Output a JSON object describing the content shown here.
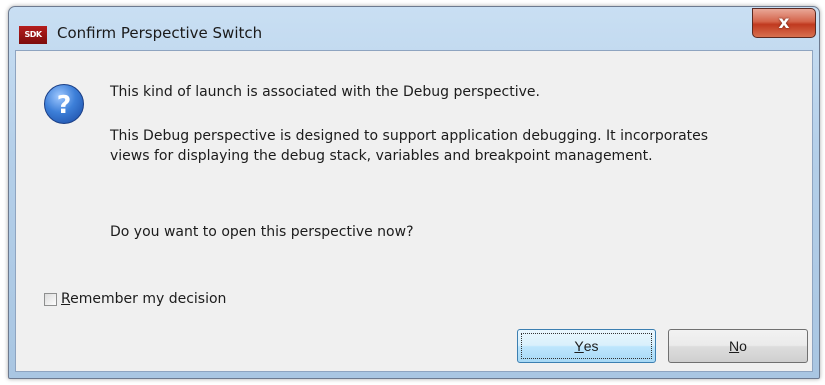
{
  "window": {
    "title": "Confirm Perspective Switch",
    "app_icon_text": "SDK",
    "close_symbol": "x"
  },
  "message": {
    "line1": "This kind of launch is associated with the Debug perspective.",
    "line2": "This Debug perspective is designed to support application debugging.  It incorporates views for displaying the debug stack, variables and breakpoint management.",
    "line3": "Do you want to open this perspective now?"
  },
  "remember": {
    "mnemonic": "R",
    "label_rest": "emember my decision",
    "checked": false
  },
  "buttons": {
    "yes_mnemonic": "Y",
    "yes_rest": "es",
    "no_mnemonic": "N",
    "no_rest": "o"
  },
  "icons": {
    "dialog_icon": "question-icon",
    "question_glyph": "?"
  },
  "colors": {
    "titlebar": "#b4cfe9",
    "close_button": "#c0391f",
    "client_bg": "#f0f0f0",
    "default_button_border": "#3c7fb1"
  }
}
